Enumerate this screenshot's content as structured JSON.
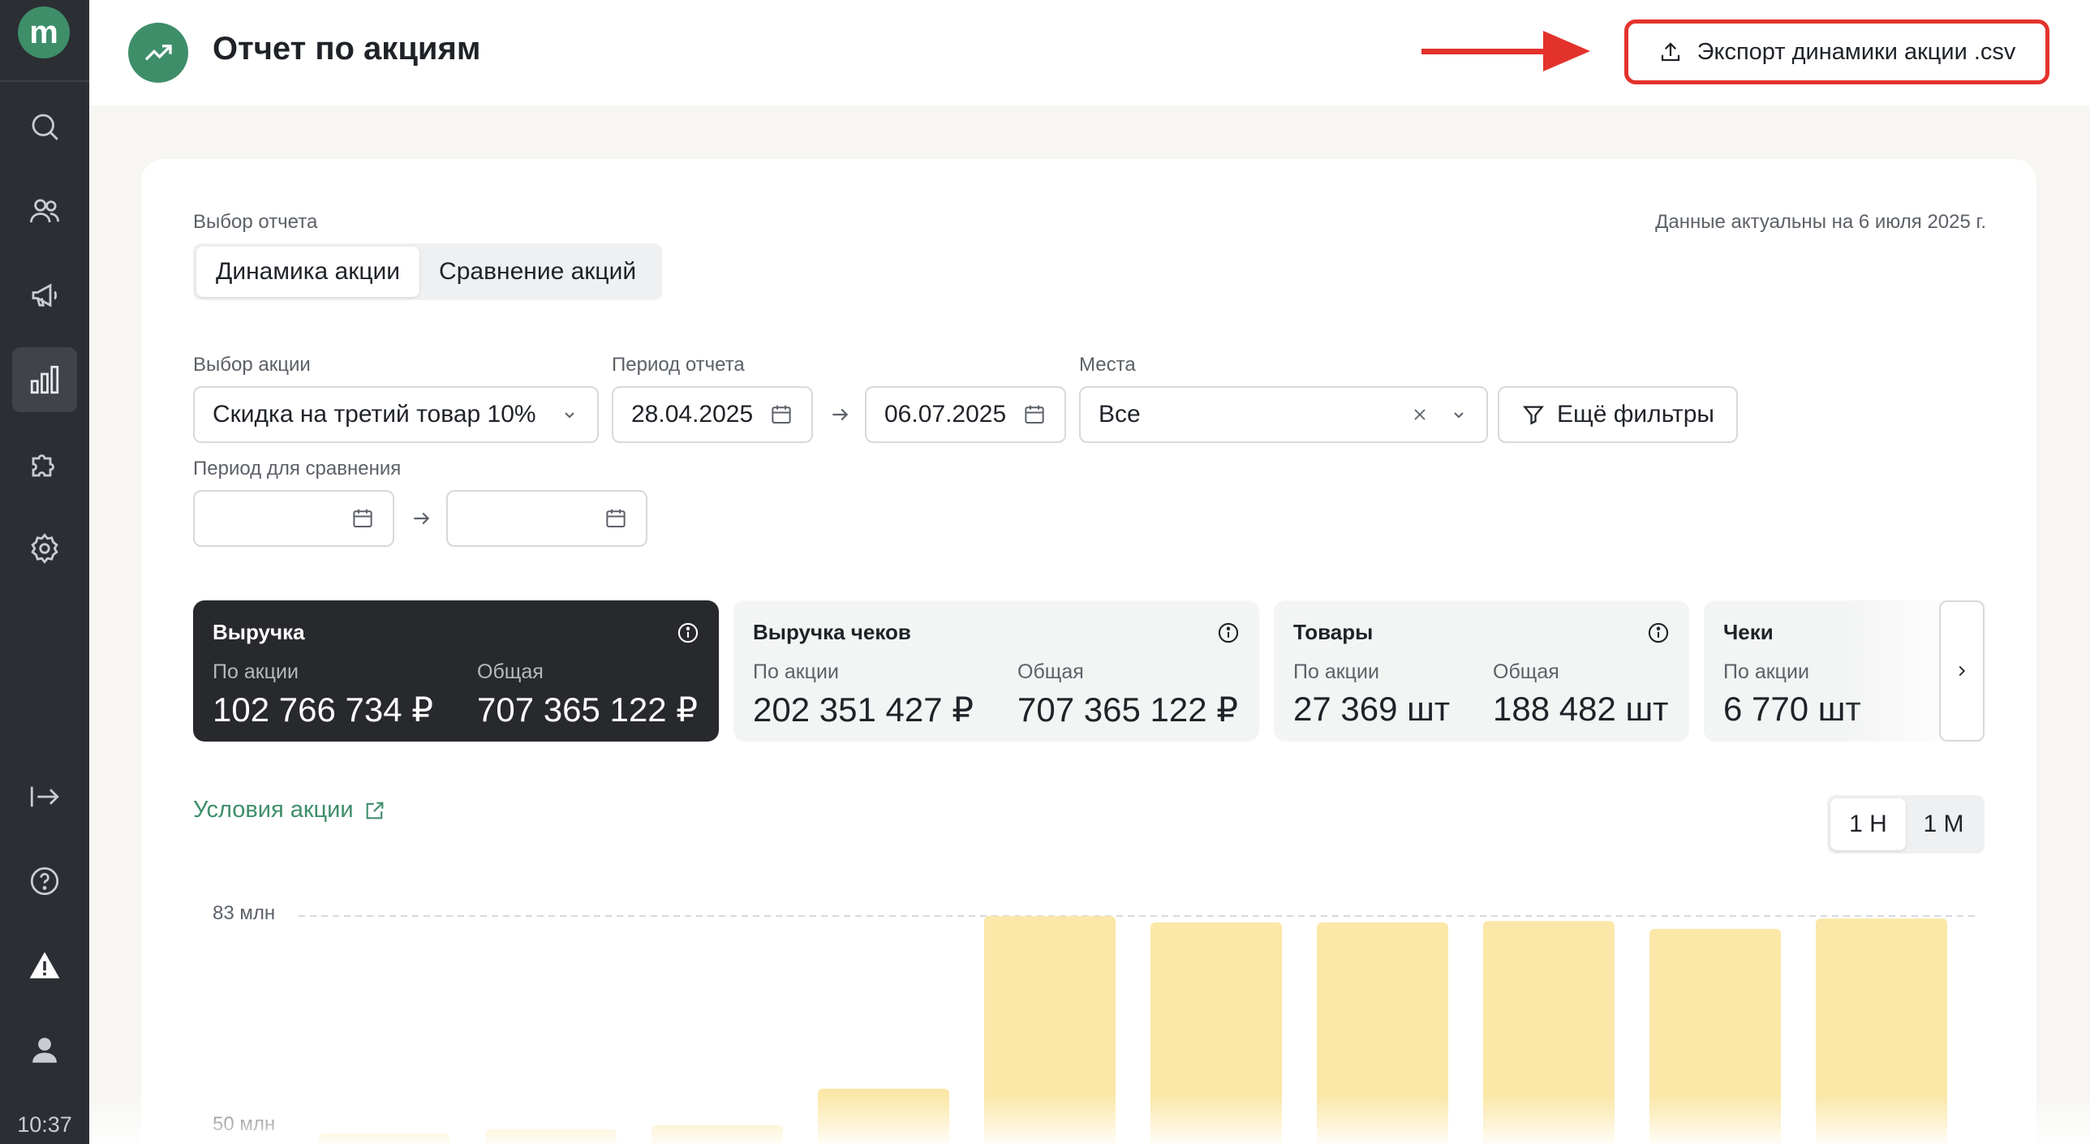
{
  "sidebar": {
    "logo_letter": "m",
    "items": [
      {
        "name": "search-icon"
      },
      {
        "name": "users-icon"
      },
      {
        "name": "megaphone-icon"
      },
      {
        "name": "analytics-icon",
        "active": true
      },
      {
        "name": "puzzle-icon"
      },
      {
        "name": "gear-icon"
      },
      {
        "name": "logout-icon"
      },
      {
        "name": "help-icon"
      },
      {
        "name": "warning-icon"
      },
      {
        "name": "user-icon"
      }
    ],
    "time": "10:37"
  },
  "header": {
    "title": "Отчет по акциям",
    "export_label": "Экспорт динамики акции .csv"
  },
  "report": {
    "select_label": "Выбор отчета",
    "data_date": "Данные актуальны на 6 июля 2025 г.",
    "tabs": [
      {
        "label": "Динамика акции",
        "active": true
      },
      {
        "label": "Сравнение акций",
        "active": false
      }
    ]
  },
  "filters": {
    "promo_label": "Выбор акции",
    "promo_value": "Скидка на третий товар 10%",
    "period_label": "Период отчета",
    "period_start": "28.04.2025",
    "period_end": "06.07.2025",
    "places_label": "Места",
    "places_value": "Все",
    "more_filters": "Ещё фильтры",
    "compare_label": "Период для сравнения",
    "compare_start": "",
    "compare_end": ""
  },
  "kpis": [
    {
      "title": "Выручка",
      "sub1": "По акции",
      "val1": "102 766 734 ₽",
      "sub2": "Общая",
      "val2": "707 365 122 ₽",
      "active": true
    },
    {
      "title": "Выручка чеков",
      "sub1": "По акции",
      "val1": "202 351 427 ₽",
      "sub2": "Общая",
      "val2": "707 365 122 ₽"
    },
    {
      "title": "Товары",
      "sub1": "По акции",
      "val1": "27 369 шт",
      "sub2": "Общая",
      "val2": "188 482 шт"
    },
    {
      "title": "Чеки",
      "sub1": "По акции",
      "val1": "6 770 шт"
    }
  ],
  "conditions_link": "Условия акции",
  "period_options": [
    {
      "label": "1 Н",
      "active": true
    },
    {
      "label": "1 М",
      "active": false
    }
  ],
  "colors": {
    "accent": "#3e8e6a",
    "highlight": "#e3322b",
    "bar": "#fbe7a8",
    "dark": "#27292d"
  },
  "chart_data": {
    "type": "bar",
    "categories": [
      "",
      "",
      "",
      "",
      "",
      "",
      "",
      "",
      "",
      ""
    ],
    "values": [
      49,
      49.6,
      50.3,
      56,
      83,
      82,
      82,
      82.2,
      81,
      82.6
    ],
    "ylim": [
      50,
      83
    ],
    "y_ticks": [
      "83 млн",
      "50 млн"
    ],
    "y_tick_values": [
      83,
      50
    ]
  }
}
